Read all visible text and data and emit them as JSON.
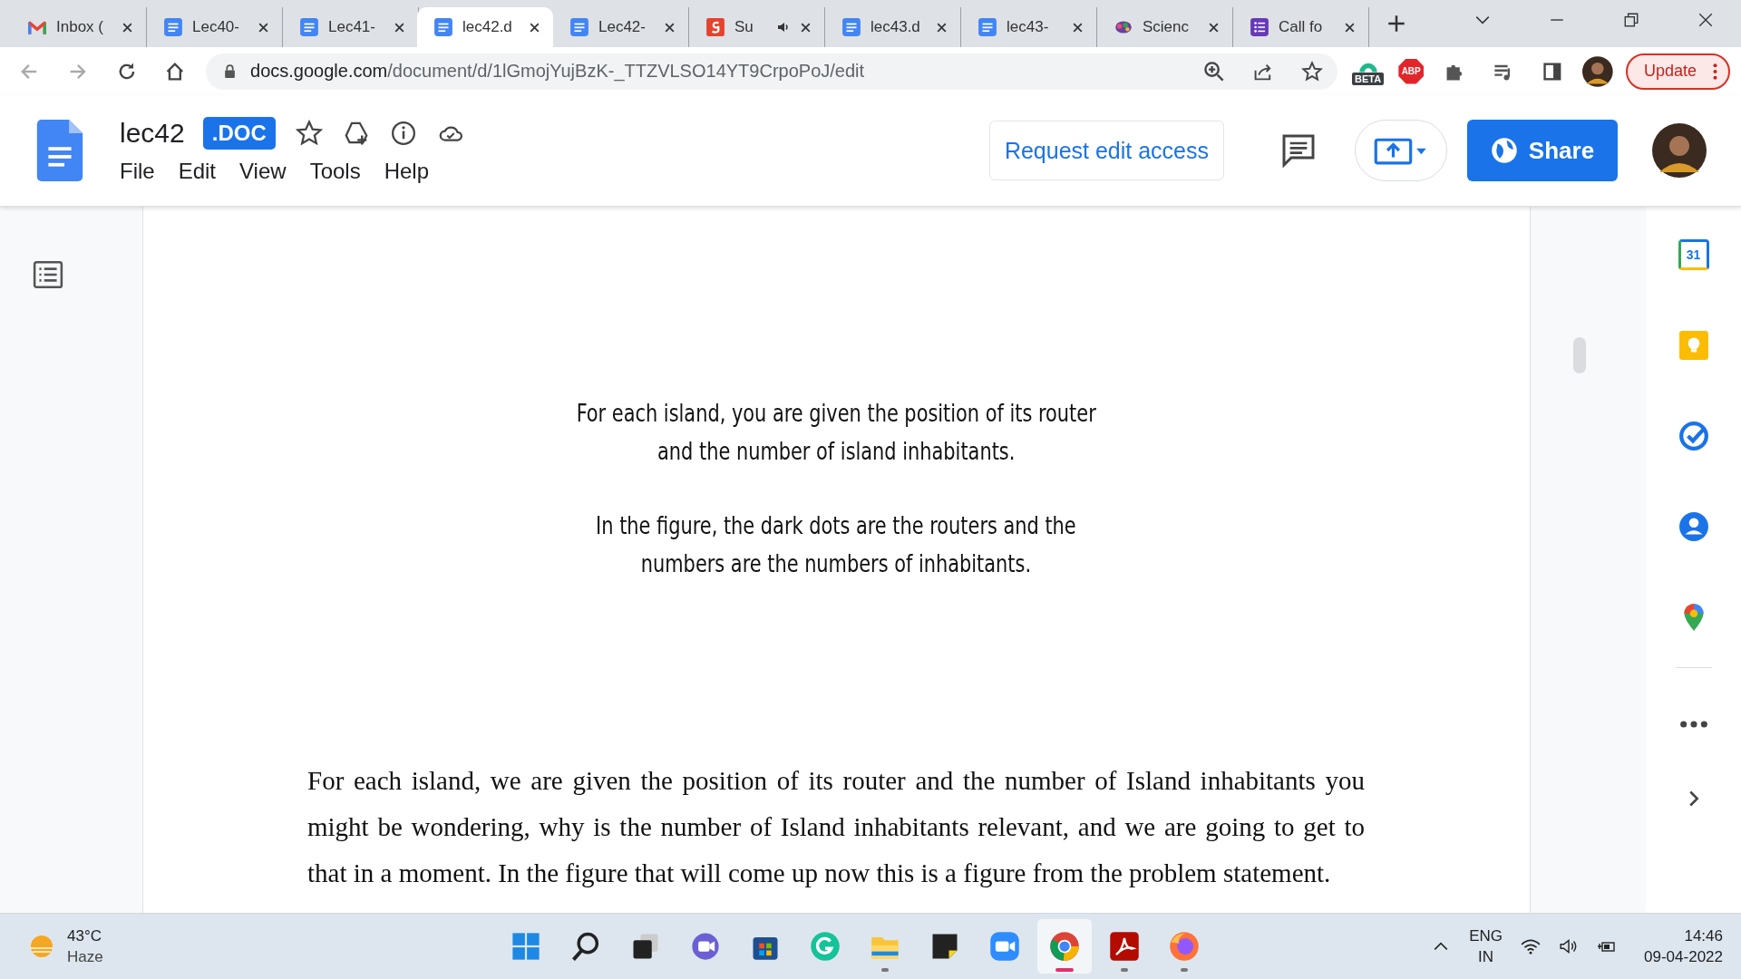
{
  "browser": {
    "tabs": [
      {
        "kind": "gmail",
        "label": "Inbox (",
        "selected": false,
        "audio": false
      },
      {
        "kind": "docs",
        "label": "Lec40-",
        "selected": false,
        "audio": false
      },
      {
        "kind": "docs",
        "label": "Lec41-",
        "selected": false,
        "audio": false
      },
      {
        "kind": "docs",
        "label": "lec42.d",
        "selected": true,
        "audio": false
      },
      {
        "kind": "docs",
        "label": "Lec42-",
        "selected": false,
        "audio": false
      },
      {
        "kind": "g",
        "label": "Su",
        "selected": false,
        "audio": true
      },
      {
        "kind": "docs",
        "label": "lec43.d",
        "selected": false,
        "audio": false
      },
      {
        "kind": "docs",
        "label": "lec43-",
        "selected": false,
        "audio": false
      },
      {
        "kind": "brain",
        "label": "Scienc",
        "selected": false,
        "audio": false
      },
      {
        "kind": "forms",
        "label": "Call fo",
        "selected": false,
        "audio": false
      }
    ],
    "url_host": "docs.google.com",
    "url_path": "/document/d/1lGmojYujBzK-_TTZVLSO14YT9CrpoPoJ/edit",
    "extension_badge": "BETA",
    "abp": "ABP",
    "update_button": "Update"
  },
  "doc": {
    "title": "lec42",
    "badge": ".DOC",
    "menu": [
      "File",
      "Edit",
      "View",
      "Tools",
      "Help"
    ],
    "request_button": "Request edit access",
    "share_button": "Share"
  },
  "slide": {
    "paragraphs": [
      "For each island, you are given the position of its router\nand the number of island inhabitants.",
      "In the figure, the dark dots are the routers and the\nnumbers are the numbers of inhabitants."
    ]
  },
  "body": "For each island, we are given the position of its router and the number of Island inhabitants you might be wondering, why is the number of Island inhabitants relevant, and we are going to get to that in a moment. In the figure that will come up now this is a figure from the problem statement.",
  "side_panel": {
    "calendar_day": "31"
  },
  "taskbar": {
    "temperature": "43°C",
    "weather": "Haze",
    "apps": [
      {
        "kind": "windows",
        "running": false,
        "active": false
      },
      {
        "kind": "search",
        "running": false,
        "active": false
      },
      {
        "kind": "taskview",
        "running": false,
        "active": false
      },
      {
        "kind": "chat",
        "running": false,
        "active": false
      },
      {
        "kind": "store",
        "running": false,
        "active": false
      },
      {
        "kind": "grammarly",
        "running": false,
        "active": false
      },
      {
        "kind": "explorer",
        "running": true,
        "active": false
      },
      {
        "kind": "sticky",
        "running": false,
        "active": false
      },
      {
        "kind": "zoom",
        "running": false,
        "active": false
      },
      {
        "kind": "chrome",
        "running": true,
        "active": true
      },
      {
        "kind": "acrobat",
        "running": true,
        "active": false
      },
      {
        "kind": "firefox",
        "running": true,
        "active": false
      }
    ],
    "language": "ENG",
    "region": "IN",
    "time": "14:46",
    "date": "09-04-2022"
  }
}
